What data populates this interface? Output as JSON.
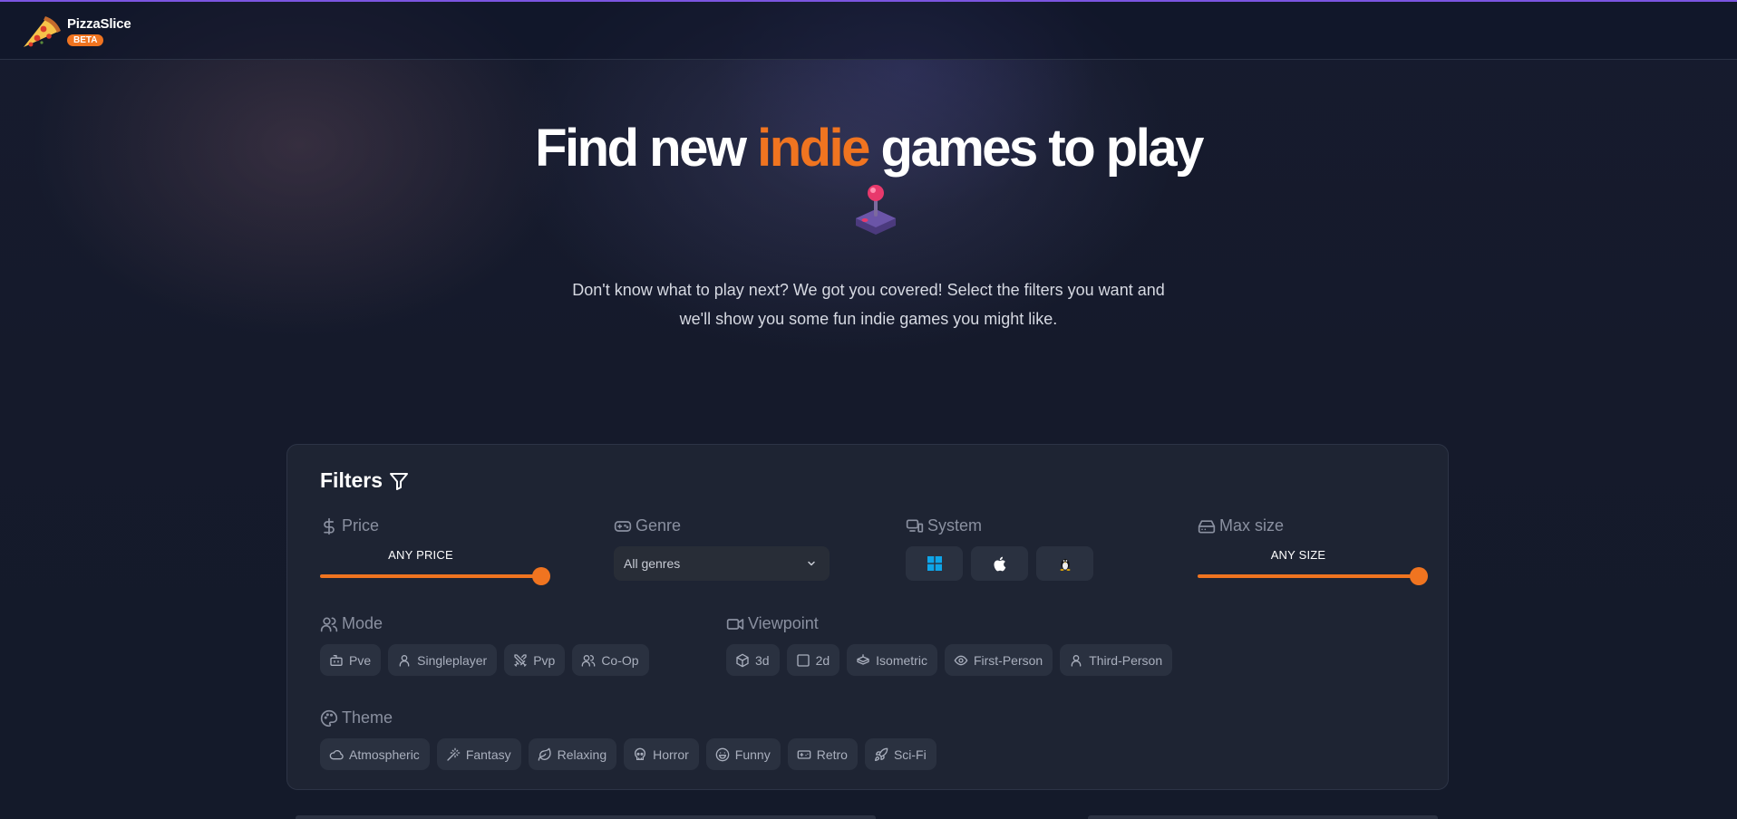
{
  "header": {
    "brand_name": "PizzaSlice",
    "badge": "BETA",
    "logo_icon": "pizza-slice-icon"
  },
  "hero": {
    "title_before": "Find new",
    "title_accent": "indie",
    "title_after": "games to play",
    "emoji_icon": "joystick-icon",
    "subtitle": "Don't know what to play next? We got you covered! Select the filters you want and we'll show you some fun indie games you might like."
  },
  "filters": {
    "title": "Filters",
    "price": {
      "label": "Price",
      "value_text": "ANY PRICE",
      "level": 1.0
    },
    "genre": {
      "label": "Genre",
      "selected": "All genres"
    },
    "system": {
      "label": "System",
      "options": [
        "windows-icon",
        "apple-icon",
        "linux-icon"
      ]
    },
    "max_size": {
      "label": "Max size",
      "value_text": "ANY SIZE",
      "level": 1.0
    },
    "mode": {
      "label": "Mode",
      "chips": [
        "Pve",
        "Singleplayer",
        "Pvp",
        "Co-Op"
      ]
    },
    "viewpoint": {
      "label": "Viewpoint",
      "chips": [
        "3d",
        "2d",
        "Isometric",
        "First-Person",
        "Third-Person"
      ]
    },
    "theme": {
      "label": "Theme",
      "chips": [
        "Atmospheric",
        "Fantasy",
        "Relaxing",
        "Horror",
        "Funny",
        "Retro",
        "Sci-Fi"
      ]
    }
  },
  "colors": {
    "accent": "#f07420",
    "background": "#141a2b",
    "card": "#1e2433",
    "chip": "#2a3140",
    "top_line": "#7b55e0"
  }
}
